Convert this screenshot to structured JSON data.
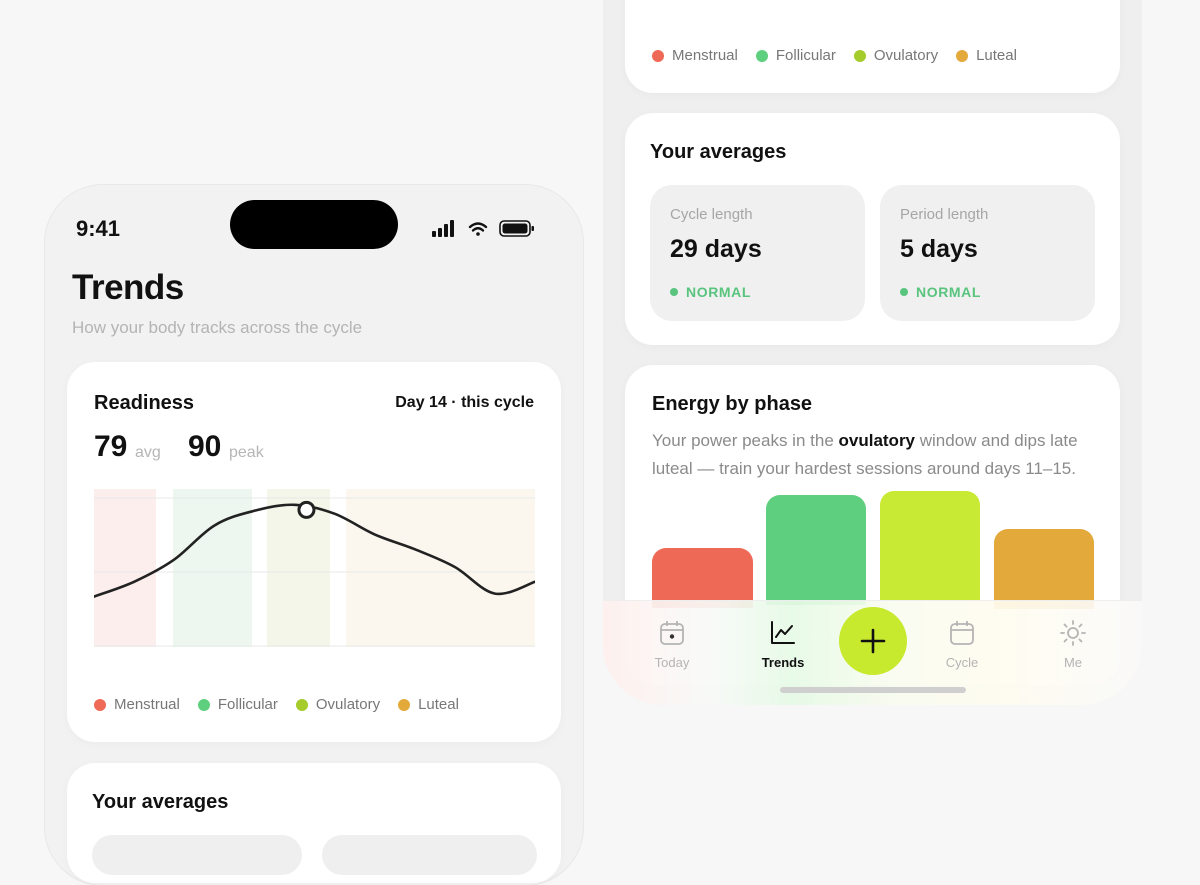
{
  "status_bar": {
    "time": "9:41"
  },
  "header": {
    "title": "Trends",
    "subtitle": "How your body tracks across the cycle"
  },
  "readiness": {
    "title": "Readiness",
    "day_label": "Day 14 · this cycle",
    "avg_value": "79",
    "avg_label": "avg",
    "peak_value": "90",
    "peak_label": "peak"
  },
  "legend": [
    {
      "label": "Menstrual",
      "color": "#ef6a56"
    },
    {
      "label": "Follicular",
      "color": "#5ecf7e"
    },
    {
      "label": "Ovulatory",
      "color": "#a5cc2a"
    },
    {
      "label": "Luteal",
      "color": "#e3a93a"
    }
  ],
  "averages": {
    "title": "Your averages",
    "tiles": [
      {
        "label": "Cycle length",
        "value": "29 days",
        "status": "NORMAL"
      },
      {
        "label": "Period length",
        "value": "5 days",
        "status": "NORMAL"
      }
    ]
  },
  "energy": {
    "title": "Energy by phase",
    "desc_before": "Your power peaks in the ",
    "desc_bold": "ovulatory",
    "desc_after": " window and dips late luteal — train your hardest sessions around days 11–15."
  },
  "chart_data": {
    "type": "line",
    "series": [
      {
        "values": [
          30,
          40,
          55,
          78,
          88,
          92,
          86,
          72,
          62,
          50,
          32,
          40
        ]
      }
    ],
    "phase_bands": [
      "Menstrual",
      "Follicular",
      "Ovulatory",
      "Luteal"
    ],
    "highlight_index": 5,
    "grid": true
  },
  "tabbar": {
    "tabs": [
      {
        "label": "Today",
        "icon": "calendar-day-icon",
        "active": false
      },
      {
        "label": "Trends",
        "icon": "line-chart-icon",
        "active": true
      },
      {
        "label": "Cycle",
        "icon": "calendar-icon",
        "active": false
      },
      {
        "label": "Me",
        "icon": "sun-gear-icon",
        "active": false
      }
    ],
    "fab_icon": "plus-icon"
  }
}
